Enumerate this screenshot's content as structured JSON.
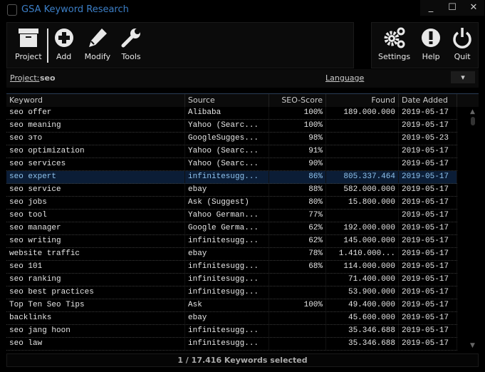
{
  "window": {
    "title": "GSA Keyword Research",
    "minimize": "_",
    "maximize": "☐",
    "close": "✕"
  },
  "toolbar": {
    "project": "Project",
    "add": "Add",
    "modify": "Modify",
    "tools": "Tools",
    "settings": "Settings",
    "help": "Help",
    "quit": "Quit"
  },
  "project_row": {
    "label": "Project:",
    "value": "seo",
    "language_label": "Language",
    "language_value": "-",
    "dropdown": "▾"
  },
  "table": {
    "columns": [
      "Keyword",
      "Source",
      "SEO-Score",
      "Found",
      "Date Added"
    ],
    "rows": [
      [
        "seo offer",
        "Alibaba",
        "100%",
        "189.000.000",
        "2019-05-17"
      ],
      [
        "seo meaning",
        "Yahoo (Searc...",
        "100%",
        "",
        "2019-05-17"
      ],
      [
        "seo это",
        "GoogleSugges...",
        "98%",
        "",
        "2019-05-23"
      ],
      [
        "seo optimization",
        "Yahoo (Searc...",
        "91%",
        "",
        "2019-05-17"
      ],
      [
        "seo services",
        "Yahoo (Searc...",
        "90%",
        "",
        "2019-05-17"
      ],
      [
        "seo expert",
        "infinitesugg...",
        "86%",
        "805.337.464",
        "2019-05-17"
      ],
      [
        "seo service",
        "ebay",
        "88%",
        "582.000.000",
        "2019-05-17"
      ],
      [
        "seo jobs",
        "Ask (Suggest)",
        "80%",
        "15.800.000",
        "2019-05-17"
      ],
      [
        "seo tool",
        "Yahoo German...",
        "77%",
        "",
        "2019-05-17"
      ],
      [
        "seo manager",
        "Google Germa...",
        "62%",
        "192.000.000",
        "2019-05-17"
      ],
      [
        "seo writing",
        "infinitesugg...",
        "62%",
        "145.000.000",
        "2019-05-17"
      ],
      [
        "website traffic",
        "ebay",
        "78%",
        "1.410.000...",
        "2019-05-17"
      ],
      [
        "seo 101",
        "infinitesugg...",
        "68%",
        "114.000.000",
        "2019-05-17"
      ],
      [
        "seo ranking",
        "infinitesugg...",
        "",
        "71.400.000",
        "2019-05-17"
      ],
      [
        "seo best practices",
        "infinitesugg...",
        "",
        "53.900.000",
        "2019-05-17"
      ],
      [
        "Top Ten Seo Tips",
        "Ask",
        "100%",
        "49.400.000",
        "2019-05-17"
      ],
      [
        "backlinks",
        "ebay",
        "",
        "45.600.000",
        "2019-05-17"
      ],
      [
        "seo jang hoon",
        "infinitesugg...",
        "",
        "35.346.688",
        "2019-05-17"
      ],
      [
        "seo law",
        "infinitesugg...",
        "",
        "35.346.688",
        "2019-05-17"
      ]
    ],
    "selected_index": 5
  },
  "status": "1 / 17.416 Keywords selected"
}
